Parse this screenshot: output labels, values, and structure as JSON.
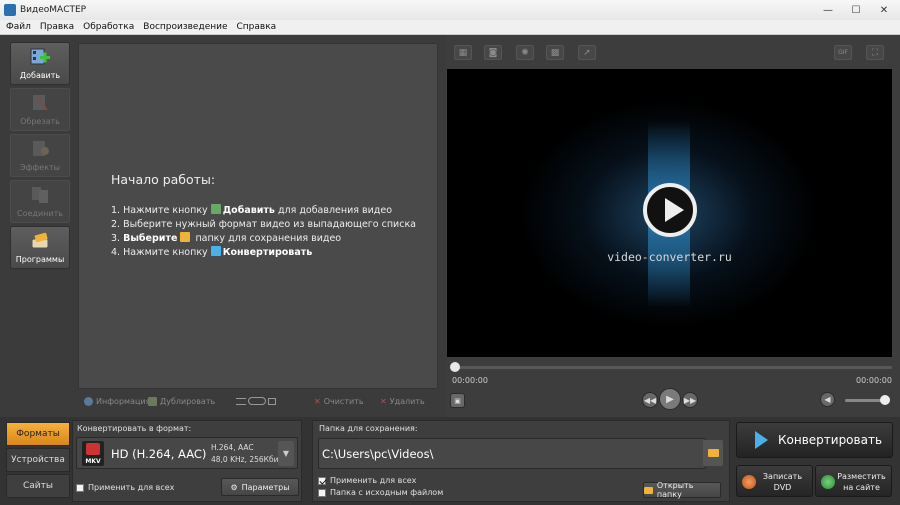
{
  "window": {
    "title": "ВидеоМАСТЕР"
  },
  "menu": [
    "Файл",
    "Правка",
    "Обработка",
    "Воспроизведение",
    "Справка"
  ],
  "tools": [
    {
      "label": "Добавить",
      "icon": "add-video-icon",
      "active": true
    },
    {
      "label": "Обрезать",
      "icon": "cut-icon",
      "active": false
    },
    {
      "label": "Эффекты",
      "icon": "effects-icon",
      "active": false
    },
    {
      "label": "Соединить",
      "icon": "join-icon",
      "active": false
    },
    {
      "label": "Программы",
      "icon": "programs-icon",
      "active": true
    }
  ],
  "welcome": {
    "title": "Начало работы:",
    "step1_a": "1. Нажмите кнопку ",
    "step1_b": "Добавить",
    "step1_c": " для добавления видео",
    "step2": "2. Выберите нужный формат видео из выпадающего списка",
    "step3_a": "3. ",
    "step3_b": "Выберите",
    "step3_c": " папку для сохранения видео",
    "step4_a": "4. Нажмите кнопку ",
    "step4_b": "Конвертировать"
  },
  "listbar": {
    "info": "Информация",
    "duplicate": "Дублировать",
    "clear": "Очистить",
    "delete": "Удалить"
  },
  "player": {
    "watermark": "video-converter.ru",
    "time_start": "00:00:00",
    "time_end": "00:00:00",
    "gif_label": "GIF"
  },
  "tabs": [
    "Форматы",
    "Устройства",
    "Сайты"
  ],
  "format": {
    "label": "Конвертировать в формат:",
    "badge": "MKV",
    "name": "HD (H.264, AAC)",
    "detail1": "H.264, AAC",
    "detail2": "48,0 KHz, 256Кбит",
    "apply_all": "Применить для всех",
    "params": "Параметры"
  },
  "save": {
    "label": "Папка для сохранения:",
    "path": "C:\\Users\\pc\\Videos\\",
    "apply_all": "Применить для всех",
    "source_folder": "Папка с исходным файлом",
    "open_folder": "Открыть папку"
  },
  "actions": {
    "convert": "Конвертировать",
    "dvd_1": "Записать",
    "dvd_2": "DVD",
    "web_1": "Разместить",
    "web_2": "на сайте"
  },
  "colors": {
    "accent_tab": "#e8a030",
    "convert_arrow": "#4ab0e8"
  }
}
